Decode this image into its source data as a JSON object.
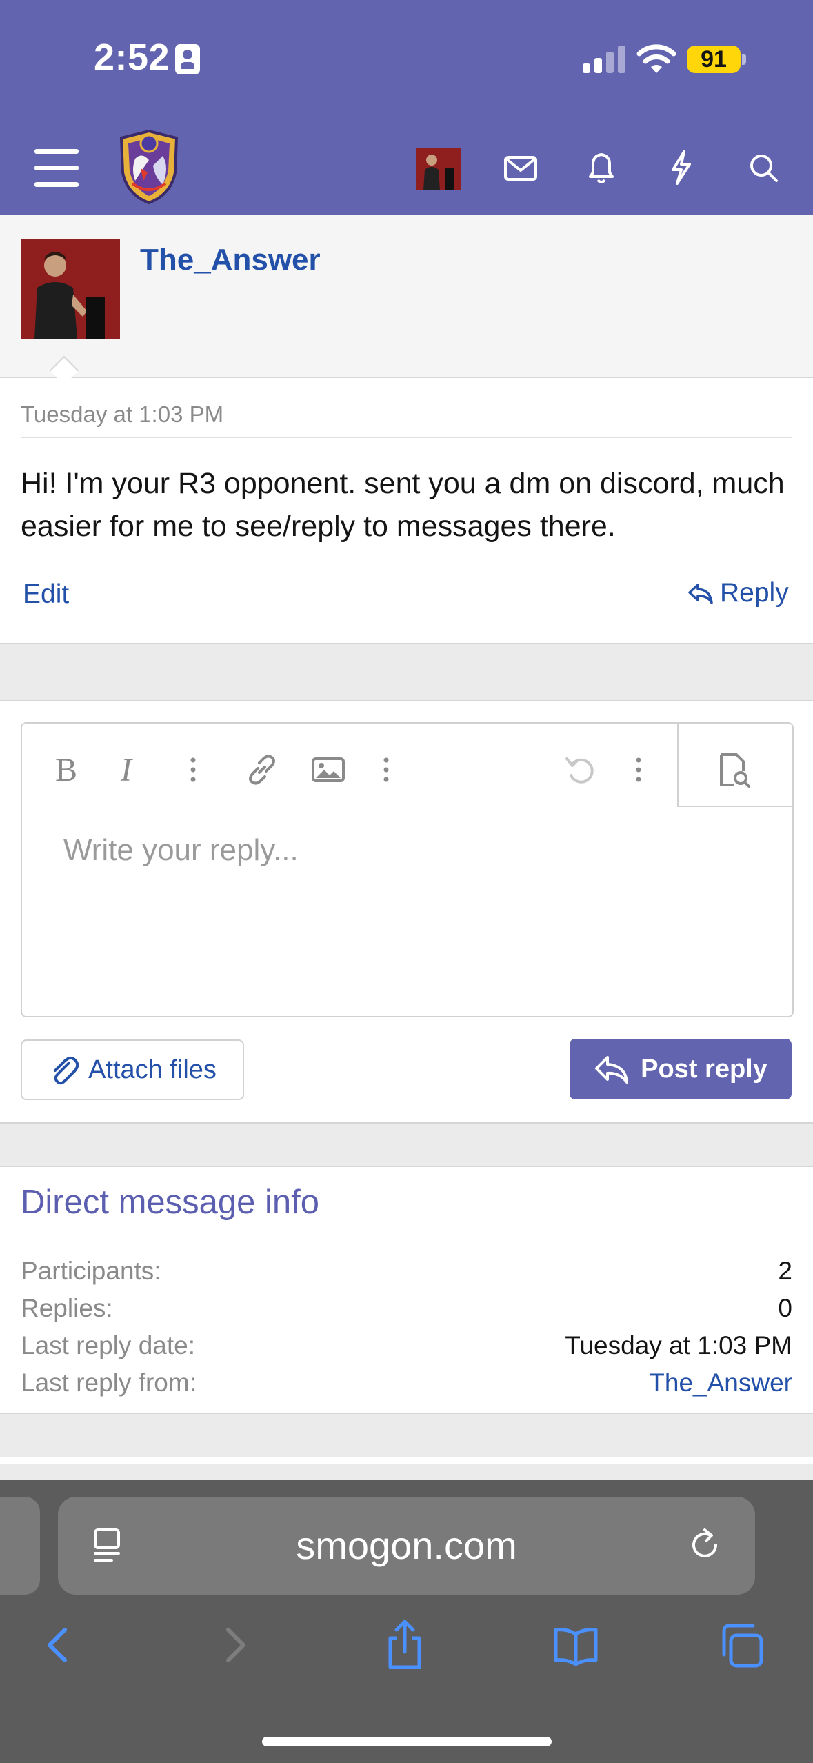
{
  "status": {
    "time": "2:52",
    "battery": "91"
  },
  "message": {
    "username": "The_Answer",
    "timestamp": "Tuesday at 1:03 PM",
    "text": "Hi! I'm your R3 opponent. sent you a dm on discord, much easier for me to see/reply to messages there.",
    "edit_label": "Edit",
    "reply_label": "Reply"
  },
  "editor": {
    "placeholder": "Write your reply...",
    "attach_label": "Attach files",
    "post_label": "Post reply"
  },
  "info": {
    "title": "Direct message info",
    "rows": [
      {
        "label": "Participants:",
        "value": "2"
      },
      {
        "label": "Replies:",
        "value": "0"
      },
      {
        "label": "Last reply date:",
        "value": "Tuesday at 1:03 PM"
      },
      {
        "label": "Last reply from:",
        "value": "The_Answer"
      }
    ]
  },
  "browser": {
    "url": "smogon.com"
  },
  "colors": {
    "brand": "#6264b0",
    "link": "#2350a8",
    "battery": "#ffd60a"
  }
}
